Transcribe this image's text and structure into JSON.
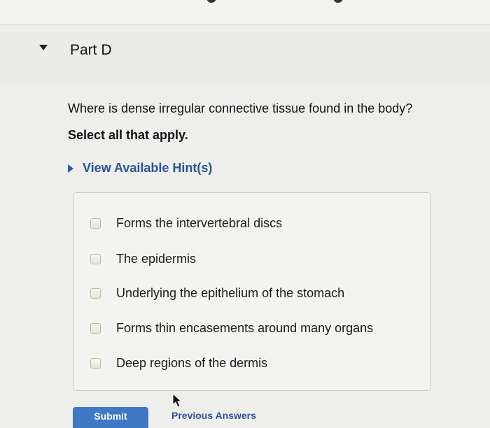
{
  "part": {
    "title": "Part D"
  },
  "question": {
    "text": "Where is dense irregular connective tissue found in the body?",
    "instruction": "Select all that apply."
  },
  "hint": {
    "label": "View Available Hint(s)"
  },
  "options": [
    {
      "label": "Forms the intervertebral discs",
      "checked": false
    },
    {
      "label": "The epidermis",
      "checked": false
    },
    {
      "label": "Underlying the epithelium of the stomach",
      "checked": false
    },
    {
      "label": "Forms thin encasements around many organs",
      "checked": false
    },
    {
      "label": "Deep regions of the dermis",
      "checked": false
    }
  ],
  "actions": {
    "submit_label": "Submit",
    "previous_answers_label": "Previous Answers"
  },
  "colors": {
    "link": "#2a5499",
    "submit_background": "#3f78c5",
    "panel_border": "#c9c9c6"
  },
  "icons": {
    "collapse": "caret-down-icon",
    "hint": "caret-right-icon",
    "cursor": "arrow-cursor-icon"
  }
}
